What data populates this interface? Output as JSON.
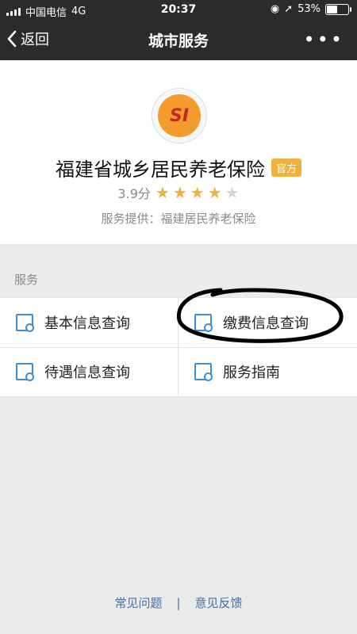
{
  "status_bar": {
    "carrier": "中国电信",
    "network": "4G",
    "time": "20:37",
    "battery": "53%",
    "battery_level": 0.53
  },
  "nav": {
    "back_label": "返回",
    "title": "城市服务",
    "more": "•••"
  },
  "header": {
    "logo_text": "SI",
    "title": "福建省城乡居民养老保险",
    "badge": "官方",
    "rating": "3.9分",
    "stars_filled": 4,
    "stars_total": 5,
    "provider": "服务提供：福建居民养老保险"
  },
  "services": {
    "section_label": "服务",
    "items": [
      {
        "label": "基本信息查询"
      },
      {
        "label": "缴费信息查询"
      },
      {
        "label": "待遇信息查询"
      },
      {
        "label": "服务指南"
      }
    ]
  },
  "footer": {
    "faq": "常见问题",
    "separator": "|",
    "feedback": "意见反馈"
  },
  "colors": {
    "top_bar": "#2b2b2d",
    "badge": "#f0b23c",
    "star_filled": "#f0b23c",
    "star_empty": "#d6d6d6",
    "icon_blue": "#3a8fd6",
    "link_blue": "#4a6d9a"
  }
}
